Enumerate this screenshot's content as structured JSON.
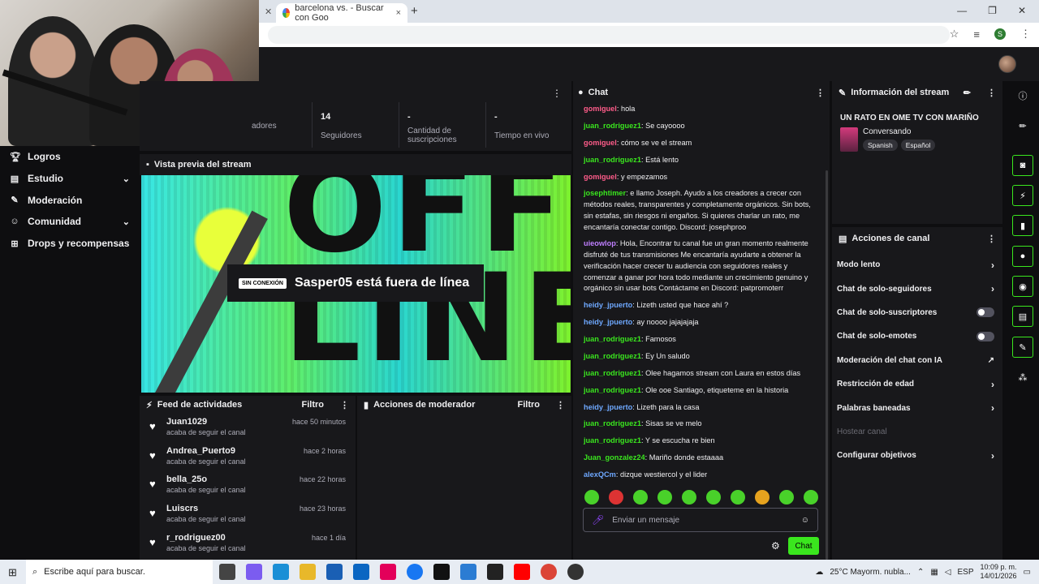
{
  "browser": {
    "tab_title": "barcelona vs. - Buscar con Goo",
    "tab_close": "×",
    "new_tab": "+",
    "profile_initial": "S"
  },
  "leftnav": {
    "items": [
      {
        "label": "Logros",
        "icon": "trophy-icon"
      },
      {
        "label": "Estudio",
        "icon": "studio-icon",
        "expandable": true
      },
      {
        "label": "Moderación",
        "icon": "wrench-icon"
      },
      {
        "label": "Comunidad",
        "icon": "community-icon",
        "expandable": true
      },
      {
        "label": "Drops y recompensas",
        "icon": "drops-icon"
      }
    ]
  },
  "stats": {
    "items": [
      {
        "value": "",
        "label": "adores"
      },
      {
        "value": "14",
        "label": "Seguidores"
      },
      {
        "value": "-",
        "label": "Cantidad de suscripciones"
      },
      {
        "value": "-",
        "label": "Tiempo en vivo"
      }
    ]
  },
  "preview": {
    "title": "Vista previa del stream",
    "offline_badge": "SIN CONEXIÓN",
    "offline_text": "Sasper05 está fuera de línea",
    "big_text": "OFF-LINE"
  },
  "feed": {
    "title": "Feed de actividades",
    "filter": "Filtro",
    "items": [
      {
        "name": "Juan1029",
        "time": "hace 50 minutos",
        "desc": "acaba de seguir el canal"
      },
      {
        "name": "Andrea_Puerto9",
        "time": "hace 2 horas",
        "desc": "acaba de seguir el canal"
      },
      {
        "name": "bella_25o",
        "time": "hace 22 horas",
        "desc": "acaba de seguir el canal"
      },
      {
        "name": "Luiscrs",
        "time": "hace 23 horas",
        "desc": "acaba de seguir el canal"
      },
      {
        "name": "r_rodriguez00",
        "time": "hace 1 día",
        "desc": "acaba de seguir el canal"
      }
    ]
  },
  "modactions": {
    "title": "Acciones de moderador",
    "filter": "Filtro"
  },
  "chat": {
    "title": "Chat",
    "messages": [
      {
        "user": "gomiguel",
        "color": "#ff5c8a",
        "text": "hola"
      },
      {
        "user": "juan_rodriguez1",
        "color": "#3ae61e",
        "text": "Se cayoooo"
      },
      {
        "user": "gomiguel",
        "color": "#ff5c8a",
        "text": "cómo se ve el stream"
      },
      {
        "user": "juan_rodriguez1",
        "color": "#3ae61e",
        "text": "Está lento"
      },
      {
        "user": "gomiguel",
        "color": "#ff5c8a",
        "text": "y empezamos"
      },
      {
        "user": "josephtimer",
        "color": "#3ae61e",
        "text": "e llamo Joseph. Ayudo a los creadores a crecer con métodos reales, transparentes y completamente orgánicos. Sin bots, sin estafas, sin riesgos ni engaños. Si quieres charlar un rato, me encantaría conectar contigo. Discord: josephproo"
      },
      {
        "user": "uieowlop",
        "color": "#bf7fff",
        "text": "Hola, Encontrar tu canal fue un gran momento realmente disfruté de tus transmisiones Me encantaría ayudarte a obtener la verificación hacer crecer tu audiencia con seguidores reales y comenzar a ganar por hora todo mediante un crecimiento genuino y orgánico sin usar bots Contáctame en Discord: patpromoterr"
      },
      {
        "user": "heidy_jpuerto",
        "color": "#6ea8ff",
        "text": "Lizeth usted que hace ahí ?"
      },
      {
        "user": "heidy_jpuerto",
        "color": "#6ea8ff",
        "text": "ay noooo jajajajaja"
      },
      {
        "user": "juan_rodriguez1",
        "color": "#3ae61e",
        "text": "Famosos"
      },
      {
        "user": "juan_rodriguez1",
        "color": "#3ae61e",
        "text": "Ey Un saludo"
      },
      {
        "user": "juan_rodriguez1",
        "color": "#3ae61e",
        "text": "Olee hagamos stream con Laura en estos días"
      },
      {
        "user": "juan_rodriguez1",
        "color": "#3ae61e",
        "text": "Ole ooe Santiago, etiqueteme en la historia"
      },
      {
        "user": "heidy_jpuerto",
        "color": "#6ea8ff",
        "text": "Lizeth para la casa"
      },
      {
        "user": "juan_rodriguez1",
        "color": "#3ae61e",
        "text": "Sisas se ve melo"
      },
      {
        "user": "juan_rodriguez1",
        "color": "#3ae61e",
        "text": "Y se escucha re bien"
      },
      {
        "user": "Juan_gonzalez24",
        "color": "#3ae61e",
        "text": "Mariño donde estaaaa"
      },
      {
        "user": "alexQCm",
        "color": "#6ea8ff",
        "text": "dizque westiercol y el lider"
      }
    ],
    "input_placeholder": "Enviar un mensaje",
    "send_label": "Chat"
  },
  "stream_info": {
    "title": "Información del stream",
    "stream_title": "UN RATO EN OME TV CON MARIÑO",
    "category": "Conversando",
    "tags": [
      "Spanish",
      "Español"
    ]
  },
  "channel_actions": {
    "title": "Acciones de canal",
    "items": [
      {
        "label": "Modo lento",
        "control": "chevron"
      },
      {
        "label": "Chat de solo-seguidores",
        "control": "chevron"
      },
      {
        "label": "Chat de solo-suscriptores",
        "control": "toggle"
      },
      {
        "label": "Chat de solo-emotes",
        "control": "toggle"
      },
      {
        "label": "Moderación del chat con IA",
        "control": "external"
      },
      {
        "label": "Restricción de edad",
        "control": "chevron"
      },
      {
        "label": "Palabras baneadas",
        "control": "chevron"
      },
      {
        "label": "Hostear canal",
        "control": "none",
        "disabled": true
      },
      {
        "label": "Configurar objetivos",
        "control": "chevron"
      }
    ]
  },
  "taskbar": {
    "search_placeholder": "Escribe aquí para buscar.",
    "weather": "25°C  Mayorm. nubla...",
    "lang": "ESP",
    "time": "10:09 p. m.",
    "date": "14/01/2026"
  },
  "colors": {
    "accent": "#3ae61e",
    "panel": "#18181b",
    "background": "#0e0e10"
  }
}
